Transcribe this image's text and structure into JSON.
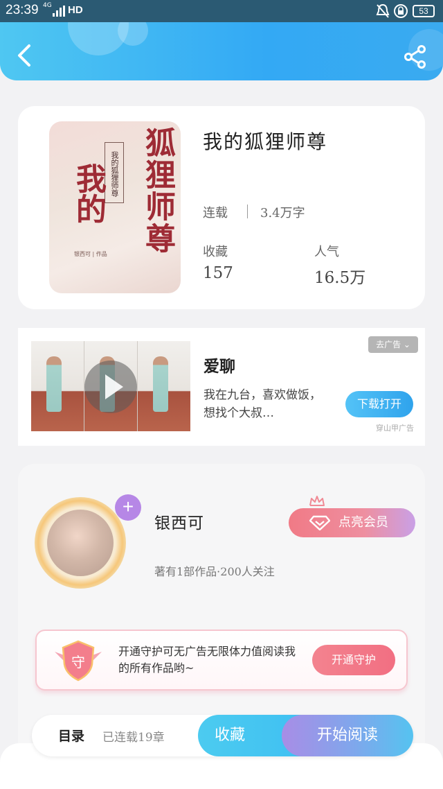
{
  "status_bar": {
    "time": "23:39",
    "network": "4G",
    "hd_label": "HD",
    "battery": "53"
  },
  "colors": {
    "header_accent": "#33a9f4",
    "vip_pink": "#f07a86",
    "read_purple": "#a88de6"
  },
  "header": {
    "back_icon": "chevron-left-icon",
    "share_icon": "share-icon"
  },
  "book": {
    "title": "我的狐狸师尊",
    "status": "连载",
    "word_count": "3.4万字",
    "favorites_label": "收藏",
    "favorites_value": "157",
    "popularity_label": "人气",
    "popularity_value": "16.5万",
    "cover": {
      "main_text_1": "狐狸师尊",
      "main_text_2": "我的",
      "subtitle": "我的狐狸师尊",
      "author_line": "银西可 | 作品"
    }
  },
  "ad": {
    "remove_ad_label": "去广告 ⌄",
    "title": "爱聊",
    "description": "我在九台，喜欢做饭，想找个大叔…",
    "download_label": "下载打开",
    "source": "穿山甲广告"
  },
  "author": {
    "name": "银西可",
    "meta": "著有1部作品·200人关注",
    "vip_label": "点亮会员",
    "follow_icon": "plus-icon"
  },
  "guard": {
    "badge_text": "守",
    "text": "开通守护可无广告无限体力值阅读我的所有作品哟~",
    "button_label": "开通守护"
  },
  "bottom_bar": {
    "toc_label": "目录",
    "chapter_count": "已连载19章",
    "favorite_label": "收藏",
    "read_label": "开始阅读"
  }
}
